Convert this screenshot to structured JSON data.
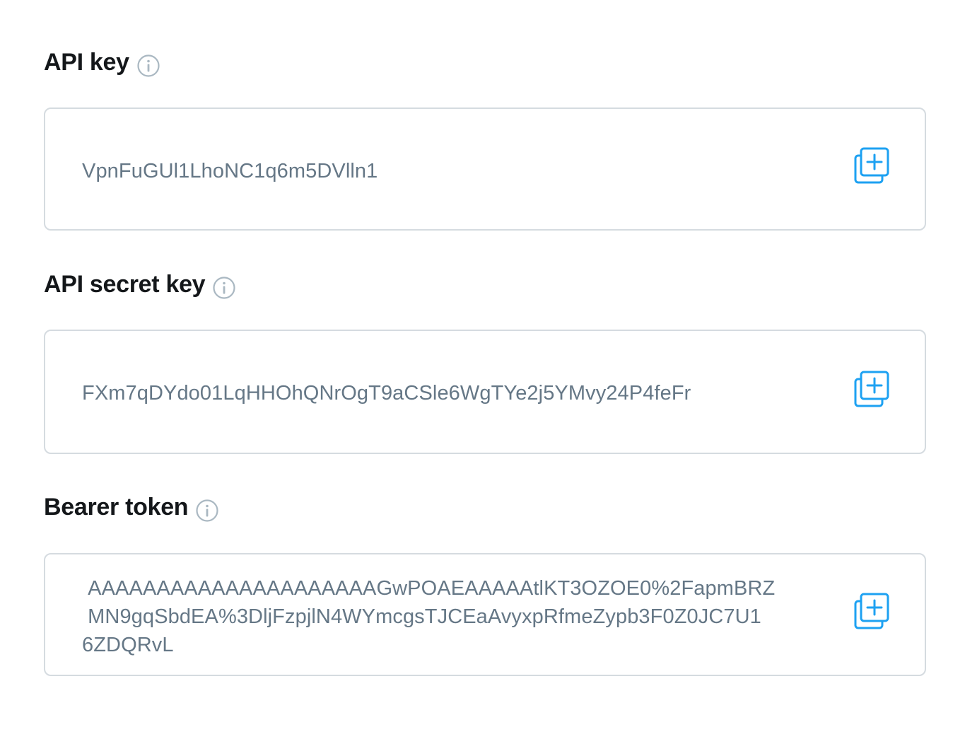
{
  "sections": [
    {
      "title": "API key",
      "value": "VpnFuGUl1LhoNC1q6m5DVlln1"
    },
    {
      "title": "API secret key",
      "value": "FXm7qDYdo01LqHHOhQNrOgT9aCSle6WgTYe2j5YMvy24P4feFr"
    },
    {
      "title": "Bearer token",
      "value": " AAAAAAAAAAAAAAAAAAAAAGwPOAEAAAAAtlKT3OZOE0%2FapmBRZ\n MN9gqSbdEA%3DljFzpjlN4WYmcgsTJCEaAvyxpRfmeZypb3F0Z0JC7U1\n6ZDQRvL"
    }
  ],
  "icons": {
    "info": "info-circle-icon",
    "copy": "copy-add-icon"
  },
  "colors": {
    "title": "#14171a",
    "value": "#657786",
    "border": "#d5dbe0",
    "accent": "#1da1f2",
    "info_icon": "#aab8c2"
  }
}
